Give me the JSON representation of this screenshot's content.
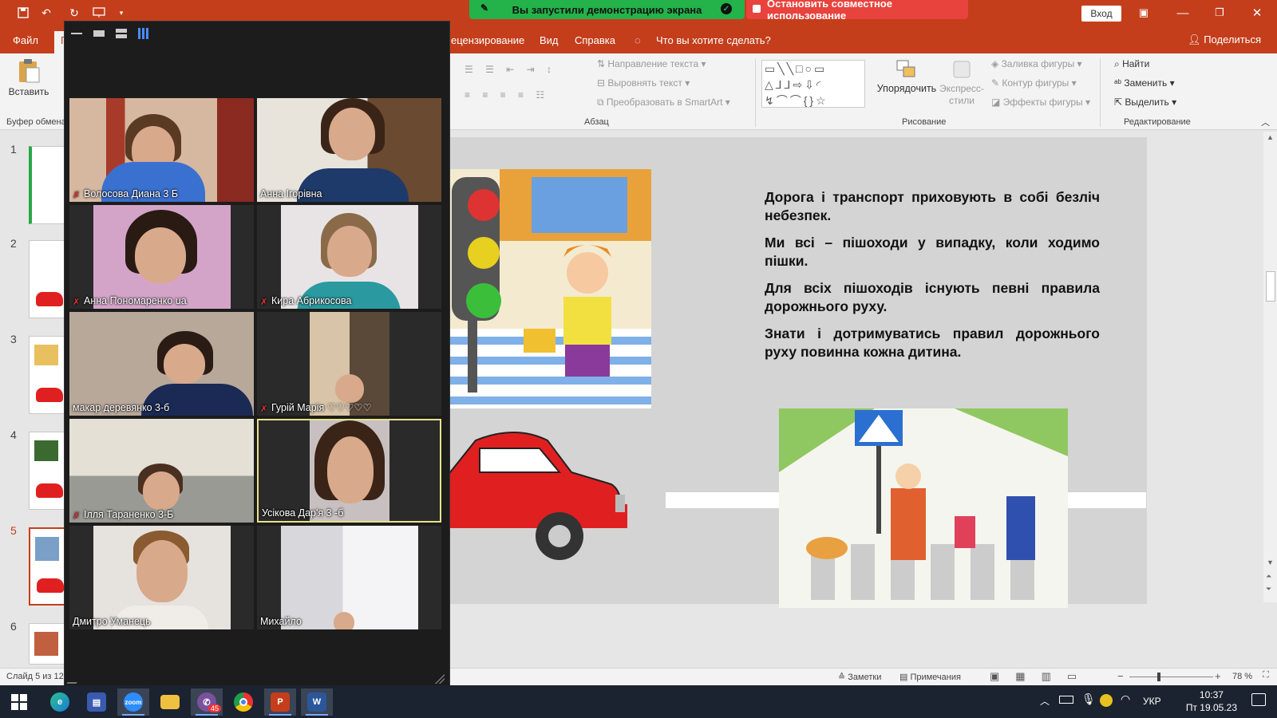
{
  "app": {
    "share_banner": "Вы запустили демонстрацию экрана",
    "stop_share": "Остановить совместное использование",
    "sign_in": "Вход",
    "colors": {
      "ppt_red": "#c43e1c",
      "share_green": "#24b24a",
      "stop_red": "#e8433d"
    }
  },
  "ribbon": {
    "tabs": [
      "Файл",
      "Г",
      "ецензирование",
      "Вид",
      "Справка"
    ],
    "tell_me": "Что вы хотите сделать?",
    "share": "Поделиться",
    "paste": "Вставить",
    "clipboard_group": "Буфер обмена",
    "paragraph_group": "Абзац",
    "text_direction": "Направление текста",
    "align_text": "Выровнять текст",
    "convert_smartart": "Преобразовать в SmartArt",
    "drawing_group": "Рисование",
    "arrange": "Упорядочить",
    "quick_styles": "Экспресс-стили",
    "shape_fill": "Заливка фигуры",
    "shape_outline": "Контур фигуры",
    "shape_effects": "Эффекты фигуры",
    "find": "Найти",
    "replace": "Заменить",
    "select": "Выделить",
    "editing_group": "Редактирование"
  },
  "thumbnails": {
    "numbers": [
      "1",
      "2",
      "3",
      "4",
      "5",
      "6"
    ],
    "selected": "5"
  },
  "slide": {
    "paragraphs": [
      "Дорога і транспорт приховують в собі безліч небезпек.",
      "Ми всі – пішоходи у випадку, коли ходимо пішки.",
      "Для всіх пішоходів існують певні правила дорожнього руху.",
      "Знати і дотримуватись правил дорожнього руху повинна кожна дитина."
    ]
  },
  "zoom": {
    "participants": [
      {
        "name": "Волосова Диана 3 Б",
        "muted": true
      },
      {
        "name": "Анна Ігорівна",
        "muted": false
      },
      {
        "name": "Анна Пономаренко ua",
        "muted": true
      },
      {
        "name": "Кира Абрикосова",
        "muted": true
      },
      {
        "name": "макар деревянко 3-б",
        "muted": false
      },
      {
        "name": "Гурій Марія ♡♡♡♡♡",
        "muted": true
      },
      {
        "name": "Ілля Тараненко 3-Б",
        "muted": true
      },
      {
        "name": "Усікова Дар'я 3 -б",
        "muted": false,
        "active": true
      },
      {
        "name": "Дмитро Уманець",
        "muted": false
      },
      {
        "name": "Михайло",
        "muted": false
      }
    ]
  },
  "status": {
    "slide_info": "Слайд 5 из 12",
    "notes": "Заметки",
    "comments": "Примечания",
    "zoom_level": "78 %"
  },
  "taskbar": {
    "zoom_label": "zoom",
    "viber_badge": "45",
    "lang": "УКР",
    "time": "10:37",
    "date": "Пт 19.05.23"
  }
}
